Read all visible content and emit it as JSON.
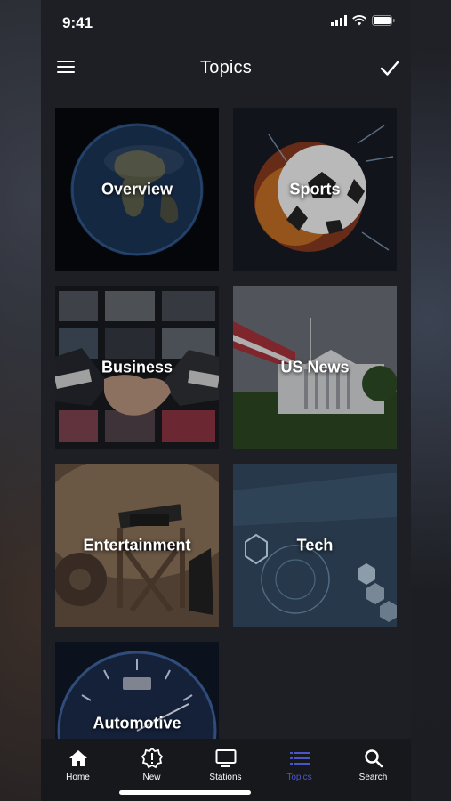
{
  "status": {
    "time": "9:41"
  },
  "header": {
    "title": "Topics"
  },
  "topics": [
    {
      "label": "Overview"
    },
    {
      "label": "Sports"
    },
    {
      "label": "Business"
    },
    {
      "label": "US News"
    },
    {
      "label": "Entertainment"
    },
    {
      "label": "Tech"
    },
    {
      "label": "Automotive"
    }
  ],
  "tabs": [
    {
      "label": "Home",
      "icon": "home-icon"
    },
    {
      "label": "New",
      "icon": "new-alert-icon"
    },
    {
      "label": "Stations",
      "icon": "tv-icon"
    },
    {
      "label": "Topics",
      "icon": "list-icon",
      "active": true
    },
    {
      "label": "Search",
      "icon": "search-icon"
    }
  ],
  "colors": {
    "accent": "#4a55c8",
    "background": "#1e1f24",
    "tabbar": "#17181c"
  }
}
